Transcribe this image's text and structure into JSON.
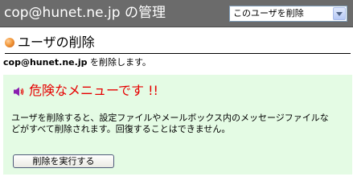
{
  "header": {
    "title": "cop@hunet.ne.jp の管理",
    "action_select": {
      "selected": "このユーザを削除"
    }
  },
  "section": {
    "title": "ユーザの削除"
  },
  "description": {
    "account": "cop@hunet.ne.jp",
    "suffix": " を削除します。"
  },
  "warning": {
    "heading": "危険なメニューです !!",
    "lines": [
      "ユーザを削除すると、設定ファイルやメールボックス内のメッセージファイルな",
      "どがすべて削除されます。回復することはできません。"
    ],
    "color": "#e60000"
  },
  "actions": {
    "execute_label": "削除を実行する"
  },
  "colors": {
    "header_bg": "#6b6b6b",
    "panel_bg": "#e4fbe4"
  }
}
